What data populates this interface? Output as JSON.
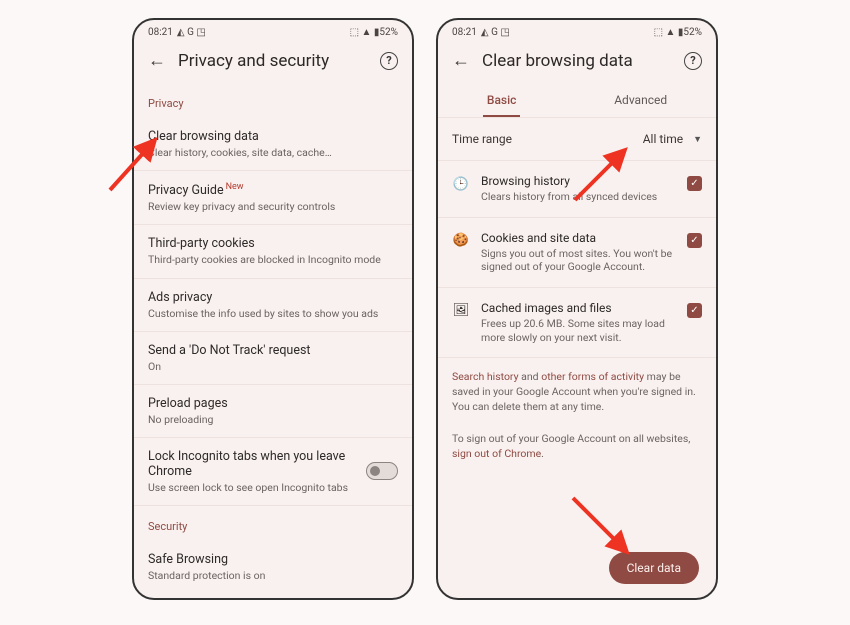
{
  "status": {
    "time": "08:21",
    "icons_left": "◭ G ◳",
    "icons_right": "⬚ ▲ ▮52%"
  },
  "left": {
    "title": "Privacy and security",
    "sec_privacy": "Privacy",
    "rows": [
      {
        "t": "Clear browsing data",
        "s": "Clear history, cookies, site data, cache…"
      },
      {
        "t": "Privacy Guide",
        "badge": "New",
        "s": "Review key privacy and security controls"
      },
      {
        "t": "Third-party cookies",
        "s": "Third-party cookies are blocked in Incognito mode"
      },
      {
        "t": "Ads privacy",
        "s": "Customise the info used by sites to show you ads"
      },
      {
        "t": "Send a 'Do Not Track' request",
        "s": "On"
      },
      {
        "t": "Preload pages",
        "s": "No preloading"
      },
      {
        "t": "Lock Incognito tabs when you leave Chrome",
        "s": "Use screen lock to see open Incognito tabs"
      }
    ],
    "sec_security": "Security",
    "safe": {
      "t": "Safe Browsing",
      "s": "Standard protection is on"
    }
  },
  "right": {
    "title": "Clear browsing data",
    "tab_basic": "Basic",
    "tab_adv": "Advanced",
    "time_label": "Time range",
    "time_value": "All time",
    "items": [
      {
        "t": "Browsing history",
        "s": "Clears history from all synced devices"
      },
      {
        "t": "Cookies and site data",
        "s": "Signs you out of most sites. You won't be signed out of your Google Account."
      },
      {
        "t": "Cached images and files",
        "s": "Frees up 20.6 MB. Some sites may load more slowly on your next visit."
      }
    ],
    "info1a": "Search history",
    "info1b": " and ",
    "info1c": "other forms of activity",
    "info1d": " may be saved in your Google Account when you're signed in. You can delete them at any time.",
    "info2a": "To sign out of your Google Account on all websites, ",
    "info2b": "sign out of Chrome",
    "info2c": ".",
    "clear_btn": "Clear data"
  }
}
